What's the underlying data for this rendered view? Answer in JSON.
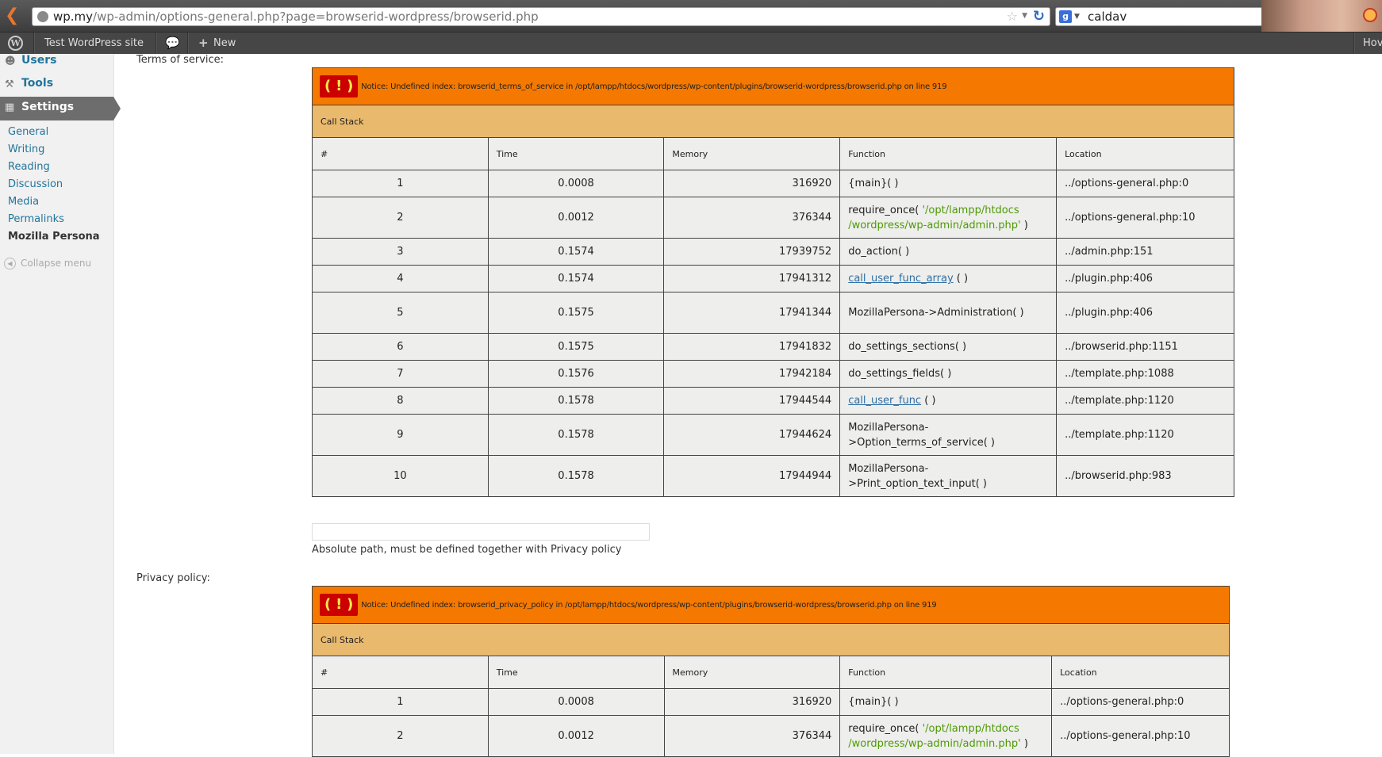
{
  "browser": {
    "url_host": "wp.my",
    "url_path": "/wp-admin/options-general.php?page=browserid-wordpress/browserid.php",
    "search_value": "caldav"
  },
  "adminbar": {
    "site_name": "Test WordPress site",
    "new_label": "New",
    "howdy_label": "Hov"
  },
  "sidebar": {
    "users_label": "Users",
    "tools_label": "Tools",
    "settings_label": "Settings",
    "submenu": [
      "General",
      "Writing",
      "Reading",
      "Discussion",
      "Media",
      "Permalinks",
      "Mozilla Persona"
    ],
    "collapse_label": "Collapse menu"
  },
  "content": {
    "tos_label": "Terms of service:",
    "tos_description": "Absolute path, must be defined together with Privacy policy",
    "privacy_label": "Privacy policy:"
  },
  "errors": [
    {
      "excl": "( ! )",
      "notice": "Notice: Undefined index: browserid_terms_of_service in /opt/lampp/htdocs/wordpress/wp-content/plugins/browserid-wordpress/browserid.php on line 919",
      "call_stack_label": "Call Stack",
      "headers": [
        "#",
        "Time",
        "Memory",
        "Function",
        "Location"
      ],
      "rows": [
        {
          "n": "1",
          "time": "0.0008",
          "memory": "316920",
          "func": "{main}( )",
          "func_link": "",
          "arg": "",
          "func_tail": "",
          "location": "../options-general.php:0"
        },
        {
          "n": "2",
          "time": "0.0012",
          "memory": "376344",
          "func": "require_once( ",
          "func_link": "",
          "arg": "'/opt/lampp/htdocs /wordpress/wp-admin/admin.php'",
          "func_tail": " )",
          "location": "../options-general.php:10"
        },
        {
          "n": "3",
          "time": "0.1574",
          "memory": "17939752",
          "func": "do_action( )",
          "func_link": "",
          "arg": "",
          "func_tail": "",
          "location": "../admin.php:151"
        },
        {
          "n": "4",
          "time": "0.1574",
          "memory": "17941312",
          "func": "",
          "func_link": "call_user_func_array",
          "arg": "",
          "func_tail": " ( )",
          "location": "../plugin.php:406"
        },
        {
          "n": "5",
          "time": "0.1575",
          "memory": "17941344",
          "func": "MozillaPersona->Administration( )",
          "func_link": "",
          "arg": "",
          "func_tail": "",
          "location": "../plugin.php:406"
        },
        {
          "n": "6",
          "time": "0.1575",
          "memory": "17941832",
          "func": "do_settings_sections( )",
          "func_link": "",
          "arg": "",
          "func_tail": "",
          "location": "../browserid.php:1151"
        },
        {
          "n": "7",
          "time": "0.1576",
          "memory": "17942184",
          "func": "do_settings_fields( )",
          "func_link": "",
          "arg": "",
          "func_tail": "",
          "location": "../template.php:1088"
        },
        {
          "n": "8",
          "time": "0.1578",
          "memory": "17944544",
          "func": "",
          "func_link": "call_user_func",
          "arg": "",
          "func_tail": " ( )",
          "location": "../template.php:1120"
        },
        {
          "n": "9",
          "time": "0.1578",
          "memory": "17944624",
          "func": "MozillaPersona->Option_terms_of_service( )",
          "func_link": "",
          "arg": "",
          "func_tail": "",
          "location": "../template.php:1120"
        },
        {
          "n": "10",
          "time": "0.1578",
          "memory": "17944944",
          "func": "MozillaPersona->Print_option_text_input( )",
          "func_link": "",
          "arg": "",
          "func_tail": "",
          "location": "../browserid.php:983"
        }
      ]
    },
    {
      "excl": "( ! )",
      "notice": "Notice: Undefined index: browserid_privacy_policy in /opt/lampp/htdocs/wordpress/wp-content/plugins/browserid-wordpress/browserid.php on line 919",
      "call_stack_label": "Call Stack",
      "headers": [
        "#",
        "Time",
        "Memory",
        "Function",
        "Location"
      ],
      "rows": [
        {
          "n": "1",
          "time": "0.0008",
          "memory": "316920",
          "func": "{main}( )",
          "func_link": "",
          "arg": "",
          "func_tail": "",
          "location": "../options-general.php:0"
        },
        {
          "n": "2",
          "time": "0.0012",
          "memory": "376344",
          "func": "require_once( ",
          "func_link": "",
          "arg": "'/opt/lampp/htdocs /wordpress/wp-admin/admin.php'",
          "func_tail": " )",
          "location": "../options-general.php:10"
        }
      ]
    }
  ]
}
